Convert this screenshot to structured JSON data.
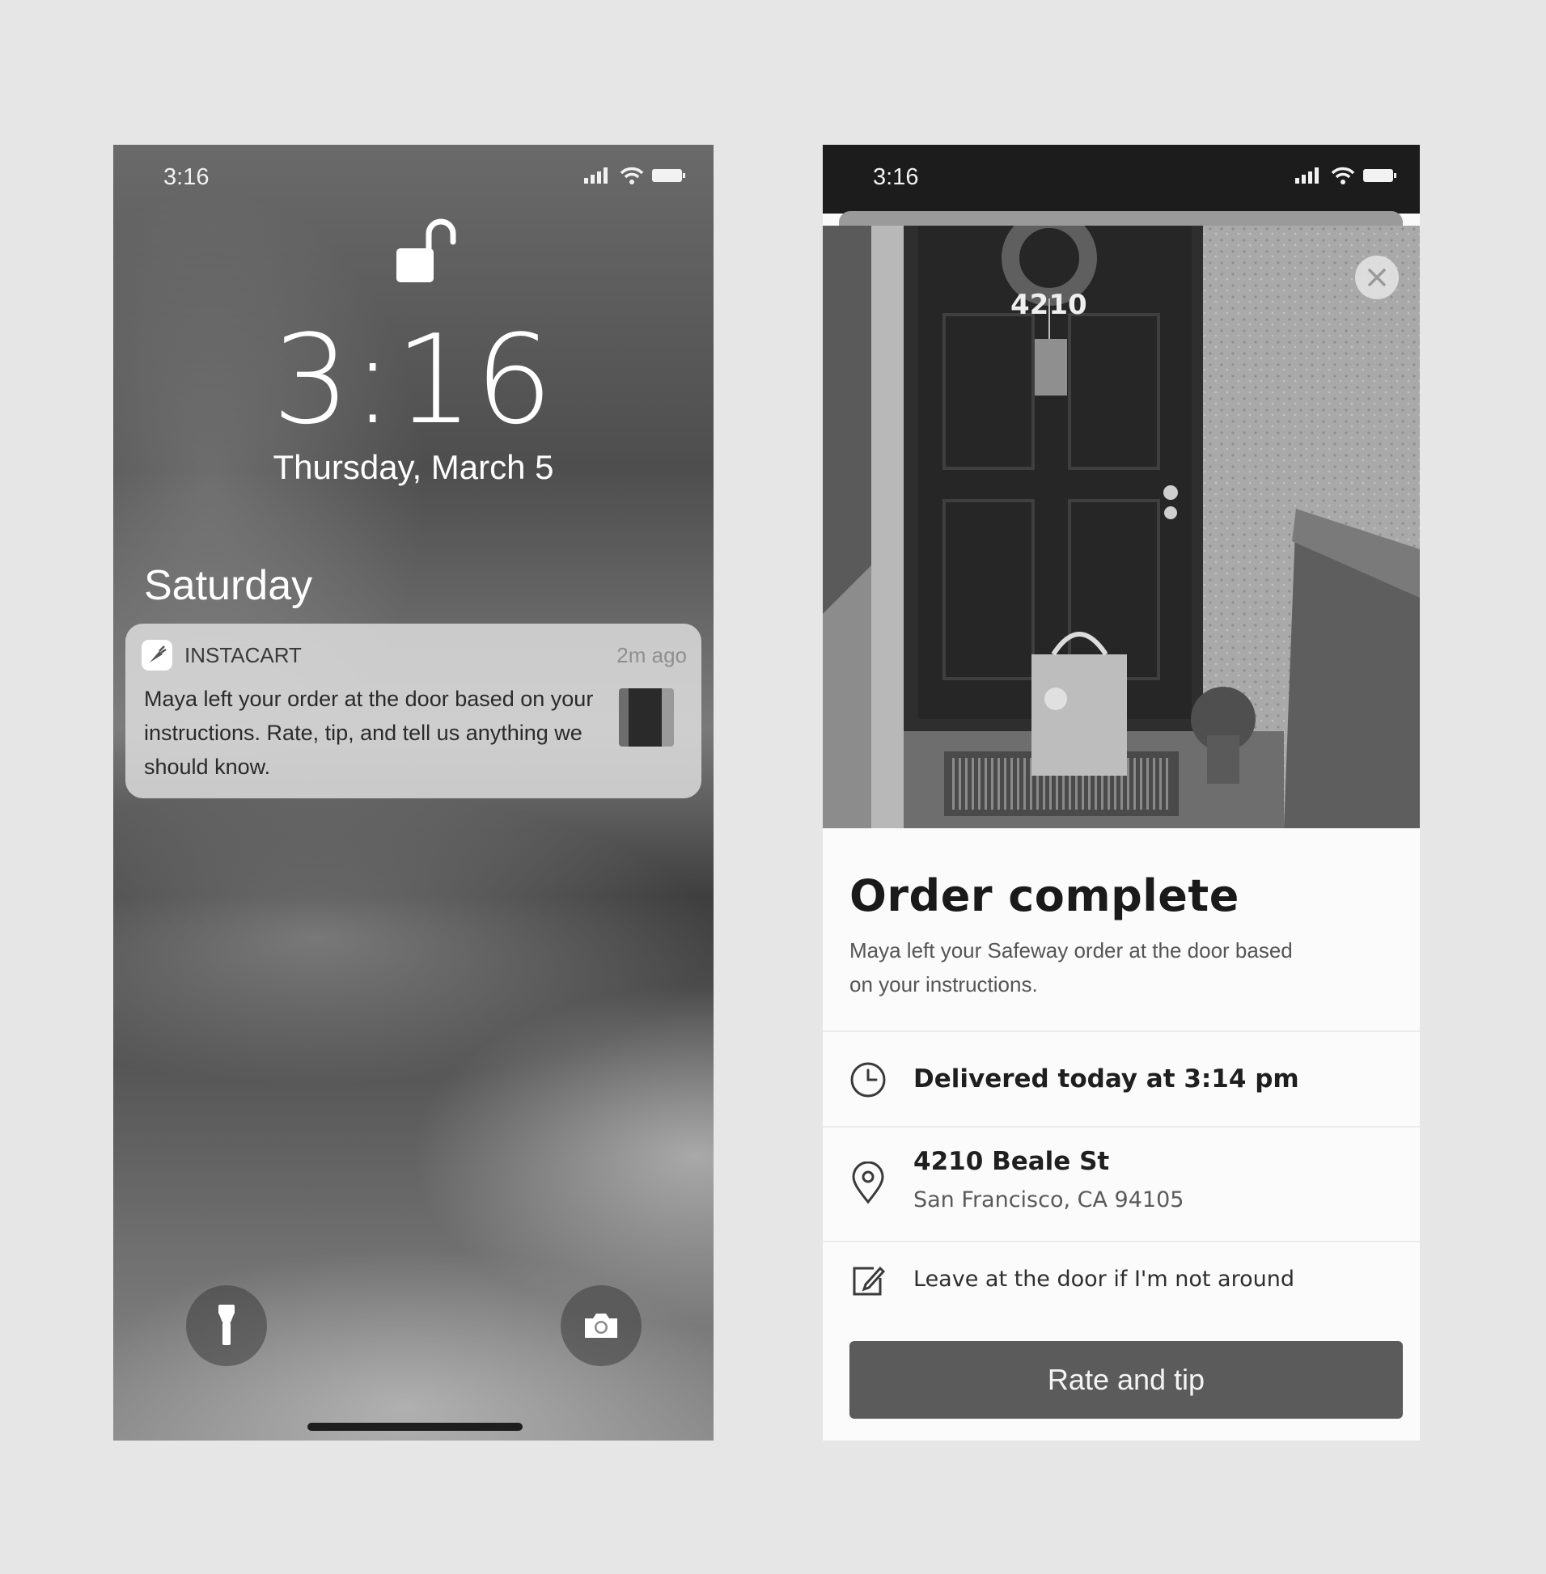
{
  "lock_screen": {
    "status_time": "3:16",
    "big_time": "3:16",
    "date": "Thursday, March 5",
    "day_header": "Saturday",
    "notification": {
      "app_name": "INSTACART",
      "time_ago": "2m ago",
      "message": "Maya left your order at the door based on your instructions. Rate, tip, and tell us anything we should know."
    }
  },
  "order_screen": {
    "status_time": "3:16",
    "door_number": "4210",
    "title": "Order complete",
    "subtitle": "Maya left your Safeway order at the door based on your instructions.",
    "delivered_text": "Delivered today at 3:14 pm",
    "address_line1": "4210 Beale St",
    "address_line2": "San Francisco, CA 94105",
    "instructions": "Leave at the door if I'm not around",
    "rate_button": "Rate and tip"
  },
  "icons": {
    "signal": "signal-icon",
    "wifi": "wifi-icon",
    "battery": "battery-icon",
    "unlock": "unlock-icon",
    "flashlight": "flashlight-icon",
    "camera": "camera-icon",
    "app": "instacart-carrot-icon",
    "close": "close-icon",
    "clock": "clock-icon",
    "location": "location-pin-icon",
    "edit": "edit-icon"
  },
  "colors": {
    "background": "#e6e6e6",
    "button": "#5b5b5b",
    "status_bar": "#1c1c1c"
  }
}
